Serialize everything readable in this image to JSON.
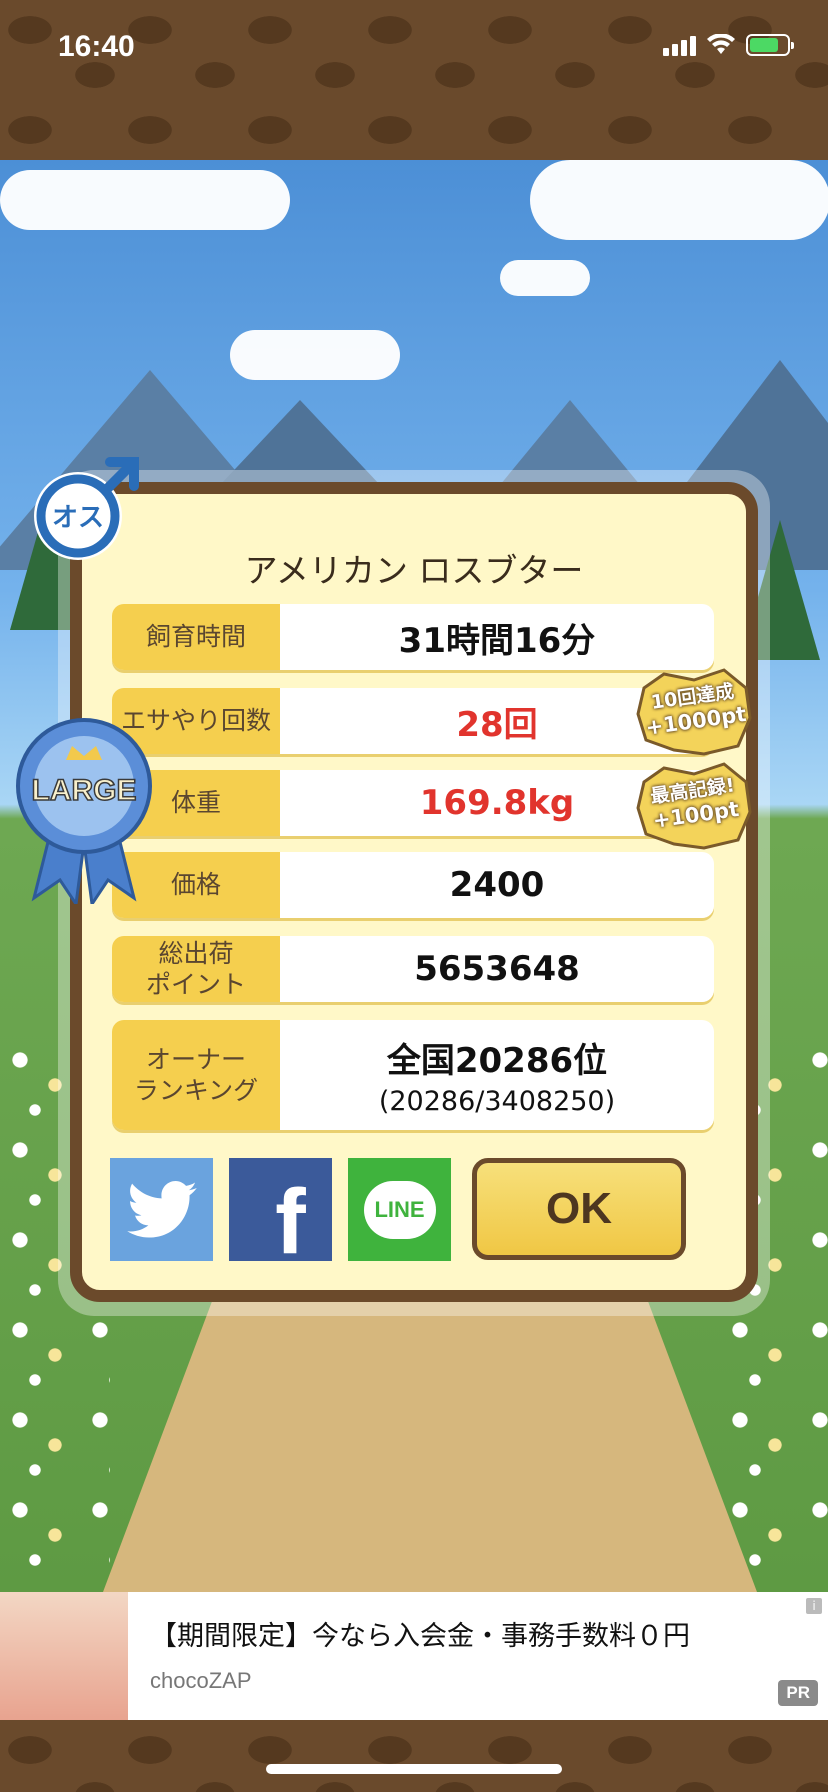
{
  "status_bar": {
    "time": "16:40"
  },
  "pet": {
    "name": "アメリカン ロスブター",
    "gender_badge": "オス",
    "size_badge": "LARGE"
  },
  "stats": [
    {
      "label": "飼育時間",
      "value": "31時間16分",
      "highlight": false
    },
    {
      "label": "エサやり回数",
      "value": "28回",
      "highlight": true
    },
    {
      "label": "体重",
      "value": "169.8kg",
      "highlight": true
    },
    {
      "label": "価格",
      "value": "2400",
      "highlight": false
    },
    {
      "label": "総出荷\nポイント",
      "value": "5653648",
      "highlight": false
    },
    {
      "label": "オーナー\nランキング",
      "value": "全国20286位",
      "sub": "(20286/3408250)",
      "highlight": false
    }
  ],
  "bonuses": [
    {
      "line1": "10回達成",
      "line2": "+1000pt"
    },
    {
      "line1": "最高記録!",
      "line2": "+100pt"
    }
  ],
  "share": {
    "twitter_icon": "twitter-icon",
    "facebook_icon": "facebook-icon",
    "facebook_glyph": "f",
    "line_icon": "line-icon",
    "line_text": "LINE"
  },
  "ok_label": "OK",
  "ad": {
    "title": "【期間限定】今なら入会金・事務手数料０円",
    "brand": "chocoZAP",
    "pr_label": "PR",
    "info_glyph": "i"
  },
  "colors": {
    "accent": "#f5cf4e",
    "frame": "#6b4a2b",
    "highlight": "#e1342d",
    "twitter": "#6aa3de",
    "facebook": "#3b5a9a",
    "line": "#3fb33d"
  }
}
